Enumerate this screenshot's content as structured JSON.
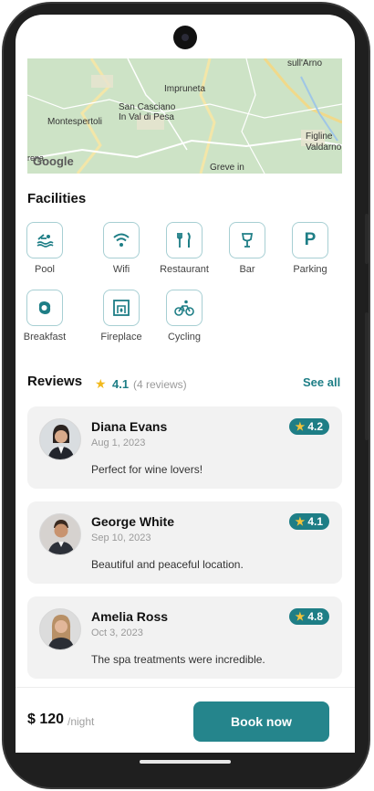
{
  "map": {
    "labels": [
      "sull'Arno",
      "Impruneta",
      "San Casciano",
      "In Val di Pesa",
      "Montespertoli",
      "Figline",
      "Valdarno",
      "Greve in"
    ],
    "logo": "Google",
    "logo_prefix": "rena"
  },
  "facilities": {
    "title": "Facilities",
    "items": [
      {
        "label": "Pool",
        "icon": "pool-icon"
      },
      {
        "label": "Wifi",
        "icon": "wifi-icon"
      },
      {
        "label": "Restaurant",
        "icon": "restaurant-icon"
      },
      {
        "label": "Bar",
        "icon": "bar-icon"
      },
      {
        "label": "Parking",
        "icon": "parking-icon"
      },
      {
        "label": "Breakfast",
        "icon": "breakfast-icon"
      },
      {
        "label": "Fireplace",
        "icon": "fireplace-icon"
      },
      {
        "label": "Cycling",
        "icon": "cycling-icon"
      }
    ]
  },
  "reviews": {
    "title": "Reviews",
    "rating": "4.1",
    "count": "(4 reviews)",
    "see_all": "See all",
    "items": [
      {
        "name": "Diana Evans",
        "date": "Aug 1, 2023",
        "rating": "4.2",
        "text": "Perfect for wine lovers!"
      },
      {
        "name": "George White",
        "date": "Sep 10, 2023",
        "rating": "4.1",
        "text": "Beautiful and peaceful location."
      },
      {
        "name": "Amelia Ross",
        "date": "Oct 3, 2023",
        "rating": "4.8",
        "text": "The spa treatments were incredible."
      }
    ]
  },
  "booking": {
    "price": "$ 120",
    "unit": "/night",
    "button": "Book now"
  },
  "colors": {
    "accent": "#25858c",
    "star": "#f2b91c",
    "card_bg": "#f2f2f2"
  }
}
